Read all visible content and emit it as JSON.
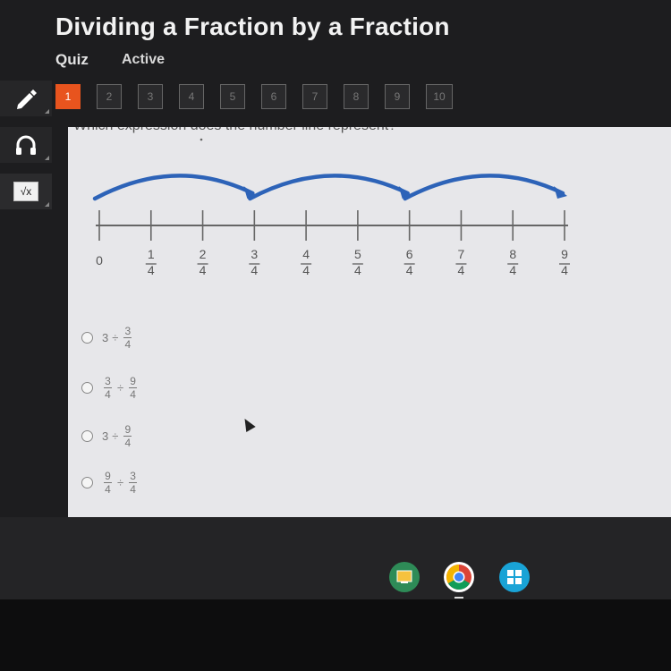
{
  "header": {
    "title": "Dividing a Fraction by a Fraction",
    "quiz_label": "Quiz",
    "status": "Active"
  },
  "tabs": [
    "1",
    "2",
    "3",
    "4",
    "5",
    "6",
    "7",
    "8",
    "9",
    "10"
  ],
  "active_tab": "1",
  "toolbar": [
    {
      "name": "pencil-icon"
    },
    {
      "name": "headphones-icon"
    },
    {
      "name": "calculator-icon",
      "label": "√x"
    }
  ],
  "question": "Which expression does the number line represent?",
  "number_line": {
    "labels": [
      {
        "whole": "0"
      },
      {
        "num": "1",
        "den": "4"
      },
      {
        "num": "2",
        "den": "4"
      },
      {
        "num": "3",
        "den": "4"
      },
      {
        "num": "4",
        "den": "4"
      },
      {
        "num": "5",
        "den": "4"
      },
      {
        "num": "6",
        "den": "4"
      },
      {
        "num": "7",
        "den": "4"
      },
      {
        "num": "8",
        "den": "4"
      },
      {
        "num": "9",
        "den": "4"
      }
    ],
    "jumps": 3,
    "line_color": "#666666",
    "arc_color": "#2d63b8"
  },
  "options": [
    {
      "a": "3",
      "op": "÷",
      "b_num": "3",
      "b_den": "4"
    },
    {
      "a_num": "3",
      "a_den": "4",
      "op": "÷",
      "b_num": "9",
      "b_den": "4"
    },
    {
      "a": "3",
      "op": "÷",
      "b_num": "9",
      "b_den": "4"
    },
    {
      "a_num": "9",
      "a_den": "4",
      "op": "÷",
      "b_num": "3",
      "b_den": "4"
    }
  ],
  "shelf": [
    {
      "name": "classroom-app-icon",
      "color": "#2e8b57"
    },
    {
      "name": "chrome-icon",
      "color": "#ffffff"
    },
    {
      "name": "apps-launcher-icon",
      "color": "#19a3d6"
    }
  ]
}
